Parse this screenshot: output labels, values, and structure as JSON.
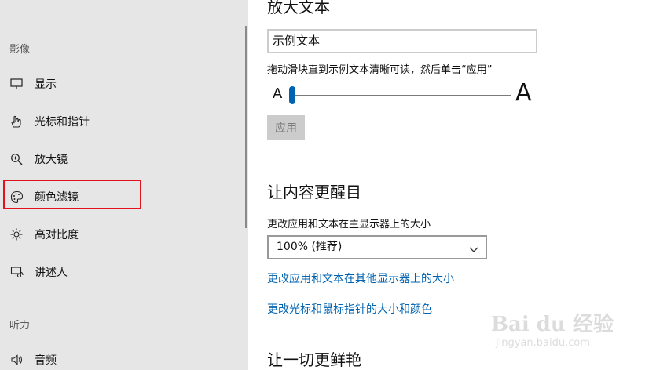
{
  "sidebar": {
    "section_vision": "影像",
    "section_hearing": "听力",
    "items": [
      {
        "label": "显示",
        "icon": "monitor-icon"
      },
      {
        "label": "光标和指针",
        "icon": "pointer-hand-icon"
      },
      {
        "label": "放大镜",
        "icon": "magnifier-icon"
      },
      {
        "label": "颜色滤镜",
        "icon": "palette-icon"
      },
      {
        "label": "高对比度",
        "icon": "brightness-icon"
      },
      {
        "label": "讲述人",
        "icon": "narrator-icon"
      },
      {
        "label": "音频",
        "icon": "speaker-icon"
      }
    ],
    "highlight_color": "#e1141e"
  },
  "main": {
    "heading_text_size": "放大文本",
    "sample_text": "示例文本",
    "slider_hint": "拖动滑块直到示例文本清晰可读，然后单击“应用”",
    "slider_small": "A",
    "slider_big": "A",
    "slider_value_fraction": 0.0,
    "apply_label": "应用",
    "heading_bigger": "让内容更醒目",
    "size_label": "更改应用和文本在主显示器上的大小",
    "size_value": "100% (推荐)",
    "link_other_displays": "更改应用和文本在其他显示器上的大小",
    "link_cursor": "更改光标和鼠标指针的大小和颜色",
    "heading_vivid": "让一切更鲜艳"
  },
  "watermark": {
    "text": "Bai du 经验",
    "url": "jingyan.baidu.com"
  },
  "colors": {
    "accent": "#0063b1",
    "sidebar_bg": "#e6e6e6"
  }
}
